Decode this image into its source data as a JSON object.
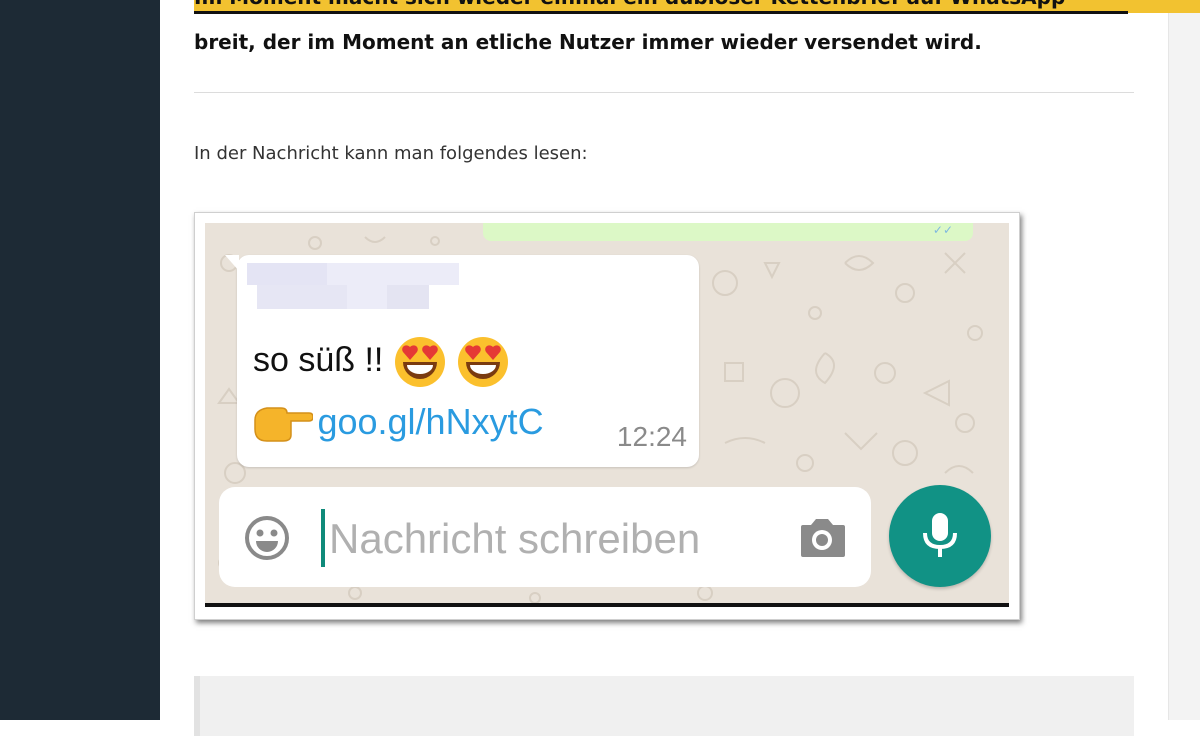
{
  "article": {
    "lead_partial": "Im Moment macht sich wieder einmal ein dubioser Kettenbrief auf WhatsApp",
    "lead_line": "breit, der im Moment an etliche Nutzer immer wieder versendet wird.",
    "paragraph": "In der Nachricht kann man folgendes lesen:"
  },
  "chat": {
    "message_text": "so süß !!",
    "emojis": [
      "heart-eyes-emoji",
      "heart-eyes-emoji"
    ],
    "pointing_emoji": "backhand-index-pointing-right-emoji",
    "link_text": "goo.gl/hNxytC",
    "time": "12:24",
    "sender_name_blurred": true,
    "input_placeholder": "Nachricht schreiben"
  },
  "icons": {
    "emoji_button": "smiley-icon",
    "camera_button": "camera-icon",
    "mic_button": "microphone-icon"
  },
  "colors": {
    "sidebar": "#1d2a35",
    "highlight": "#f2c230",
    "chat_background": "#e9e2d9",
    "outgoing_bubble": "#dcf8c6",
    "link": "#2a9be0",
    "accent": "#119285"
  }
}
